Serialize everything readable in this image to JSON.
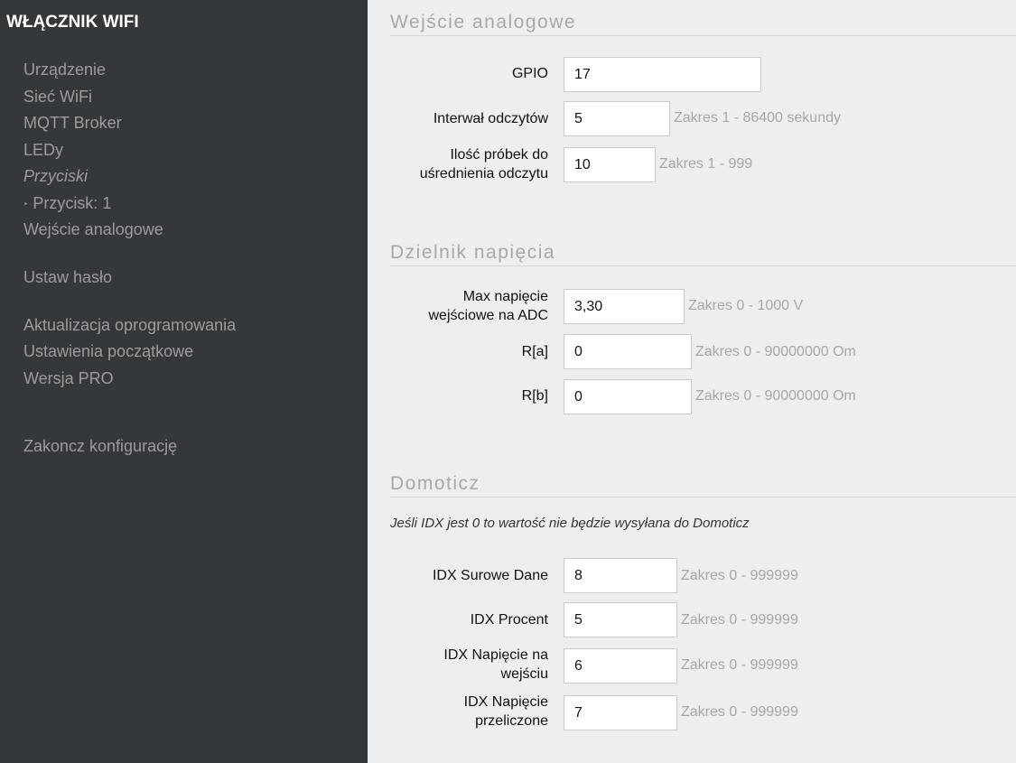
{
  "sidebar": {
    "brand": "WŁĄCZNIK WIFI",
    "items": [
      {
        "label": "Urządzenie"
      },
      {
        "label": "Sieć WiFi"
      },
      {
        "label": "MQTT Broker"
      },
      {
        "label": "LEDy"
      },
      {
        "label": "Przyciski"
      },
      {
        "label": "Przycisk: 1"
      },
      {
        "label": "Wejście analogowe"
      },
      {
        "label": "Ustaw hasło"
      },
      {
        "label": "Aktualizacja oprogramowania"
      },
      {
        "label": "Ustawienia początkowe"
      },
      {
        "label": "Wersja PRO"
      },
      {
        "label": "Zakoncz konfigurację"
      }
    ],
    "submenu_arrow": "‣"
  },
  "analog": {
    "title": "Wejście analogowe",
    "gpio": {
      "label": "GPIO",
      "value": "17"
    },
    "interval": {
      "label": "Interwał odczytów",
      "value": "5",
      "hint": "Zakres 1 - 86400 sekundy"
    },
    "samples": {
      "label_line1": "Ilość próbek do",
      "label_line2": "uśrednienia odczytu",
      "value": "10",
      "hint": "Zakres 1 - 999"
    }
  },
  "divider": {
    "title": "Dzielnik napięcia",
    "max_voltage": {
      "label_line1": "Max napięcie",
      "label_line2": "wejściowe na ADC",
      "value": "3,30",
      "hint": "Zakres 0 - 1000 V"
    },
    "ra": {
      "label": "R[a]",
      "value": "0",
      "hint": "Zakres 0 - 90000000 Om"
    },
    "rb": {
      "label": "R[b]",
      "value": "0",
      "hint": "Zakres 0 - 90000000 Om"
    }
  },
  "domoticz": {
    "title": "Domoticz",
    "note": "Jeśli IDX jest 0 to wartość nie będzie wysyłana do Domoticz",
    "raw": {
      "label": "IDX Surowe Dane",
      "value": "8",
      "hint": "Zakres 0 - 999999"
    },
    "percent": {
      "label": "IDX Procent",
      "value": "5",
      "hint": "Zakres 0 - 999999"
    },
    "input_voltage": {
      "label_line1": "IDX Napięcie na",
      "label_line2": "wejściu",
      "value": "6",
      "hint": "Zakres 0 - 999999"
    },
    "calc_voltage": {
      "label_line1": "IDX Napięcie",
      "label_line2": "przeliczone",
      "value": "7",
      "hint": "Zakres 0 - 999999"
    }
  }
}
